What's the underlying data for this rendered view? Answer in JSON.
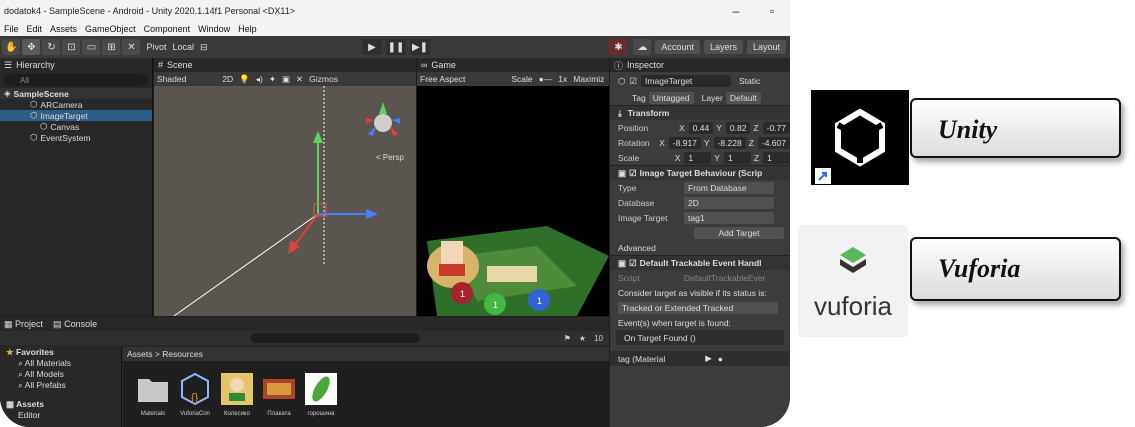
{
  "window": {
    "title": "dodatok4 - SampleScene - Android - Unity 2020.1.14f1 Personal <DX11>",
    "minimize": "–",
    "maximize": "▫"
  },
  "menu": [
    "File",
    "Edit",
    "Assets",
    "GameObject",
    "Component",
    "Window",
    "Help"
  ],
  "toolbar": {
    "pivot": "Pivot",
    "local": "Local",
    "account": "Account",
    "layers": "Layers",
    "layout": "Layout"
  },
  "hierarchy": {
    "tab": "Hierarchy",
    "search_placeholder": "All",
    "scene": "SampleScene",
    "items": [
      "ARCamera",
      "ImageTarget",
      "Canvas",
      "EventSystem"
    ]
  },
  "scene": {
    "tab": "Scene",
    "shading": "Shaded",
    "mode": "2D",
    "gizmos": "Gizmos",
    "persp": "< Persp"
  },
  "game": {
    "tab": "Game",
    "aspect": "Free Aspect",
    "scale_label": "Scale",
    "scale_value": "1x",
    "maximize": "Maximiz"
  },
  "inspector": {
    "tab": "Inspector",
    "object_name": "ImageTarget",
    "static": "Static",
    "tag_label": "Tag",
    "tag": "Untagged",
    "layer_label": "Layer",
    "layer": "Default",
    "transform": "Transform",
    "position_label": "Position",
    "position": {
      "x": "0.44",
      "y": "0.82",
      "z": "-0.77"
    },
    "rotation_label": "Rotation",
    "rotation": {
      "x": "-8.917",
      "y": "-8.228",
      "z": "-4.607"
    },
    "scale_label": "Scale",
    "scale": {
      "x": "1",
      "y": "1",
      "z": "1"
    },
    "itb": "Image Target Behaviour (Scrip",
    "type_label": "Type",
    "type": "From Database",
    "database_label": "Database",
    "database": "2D",
    "image_target_label": "Image Target",
    "image_target": "tag1",
    "add_target": "Add Target",
    "advanced": "Advanced",
    "dte": "Default Trackable Event Handl",
    "script_label": "Script",
    "script": "DefaultTrackableEver",
    "consider": "Consider target as visible if its status is:",
    "status": "Tracked or Extended Tracked",
    "events": "Event(s) when target is found:",
    "on_found": "On Target Found ()",
    "material": "tag (Material"
  },
  "project": {
    "tab_project": "Project",
    "tab_console": "Console",
    "favorites": "Favorites",
    "fav_items": [
      "All Materials",
      "All Models",
      "All Prefabs"
    ],
    "assets": "Assets",
    "editor": "Editor",
    "crumb": "Assets > Resources",
    "count": "10",
    "asset_labels": [
      "Materials",
      "VuforiaCon",
      "Колесико",
      "Плаката",
      "горошина"
    ]
  },
  "brands": {
    "unity": "Unity",
    "vuforia": "Vuforia",
    "vuforia_logo_text": "vuforia"
  },
  "colors": {
    "selection": "#2c5d87",
    "panel": "#282828",
    "inspector": "#3c3c3c"
  }
}
